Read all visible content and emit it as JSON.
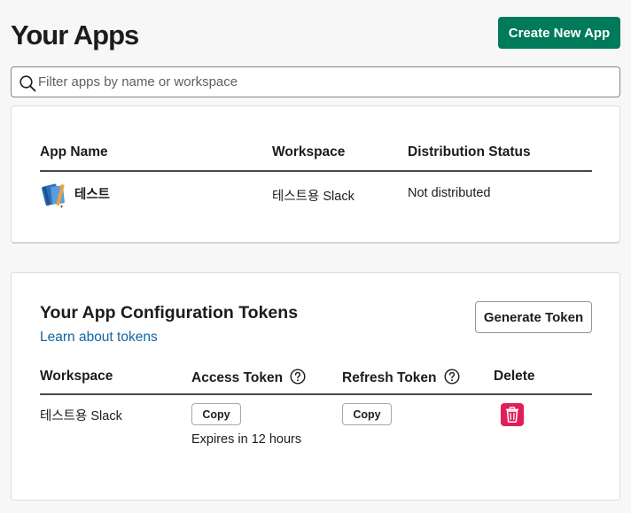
{
  "header": {
    "title": "Your Apps",
    "create_button": "Create New App"
  },
  "search": {
    "placeholder": "Filter apps by name or workspace",
    "value": ""
  },
  "apps_table": {
    "columns": [
      "App Name",
      "Workspace",
      "Distribution Status"
    ],
    "rows": [
      {
        "app_name": "테스트",
        "workspace": "테스트용 Slack",
        "distribution_status": "Not distributed",
        "icon": "notebook-icon"
      }
    ]
  },
  "tokens": {
    "title": "Your App Configuration Tokens",
    "learn_link": "Learn about tokens",
    "generate_button": "Generate Token",
    "columns": [
      "Workspace",
      "Access Token",
      "Refresh Token",
      "Delete"
    ],
    "rows": [
      {
        "workspace": "테스트용 Slack",
        "access_copy": "Copy",
        "access_expiry": "Expires in 12 hours",
        "refresh_copy": "Copy"
      }
    ]
  },
  "colors": {
    "primary_button": "#007a5a",
    "link": "#1264a3",
    "danger": "#e01e5a",
    "background": "#f7f7f7"
  }
}
